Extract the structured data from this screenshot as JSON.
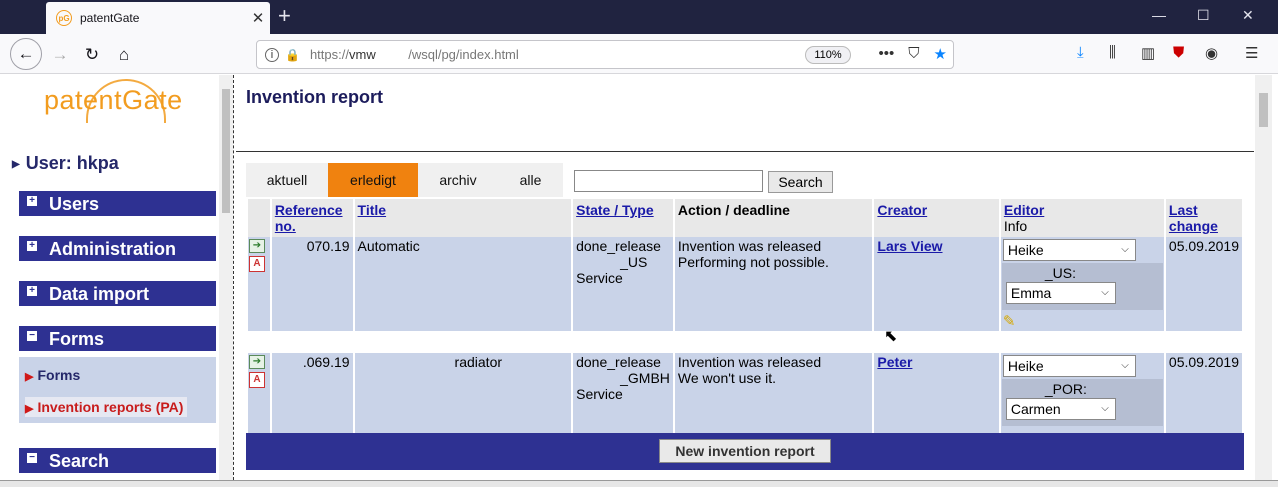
{
  "browser": {
    "tab_title": "patentGate",
    "favicon_text": "pG",
    "url_scheme": "https://",
    "url_host": "vmw",
    "url_path": "/wsql/pg/index.html",
    "zoom": "110%"
  },
  "sidebar": {
    "logo": "patentGate",
    "user": "User: hkpa",
    "menu": [
      {
        "label": "Users",
        "sign": "+"
      },
      {
        "label": "Administration",
        "sign": "+"
      },
      {
        "label": "Data import",
        "sign": "+"
      },
      {
        "label": "Forms",
        "sign": "−"
      },
      {
        "label": "Search",
        "sign": "−"
      }
    ],
    "submenu": [
      {
        "label": "Forms"
      },
      {
        "label": "Invention reports (PA)"
      }
    ]
  },
  "main": {
    "title": "Invention report",
    "filter_tabs": [
      {
        "label": "aktuell",
        "active": false
      },
      {
        "label": "erledigt",
        "active": true
      },
      {
        "label": "archiv",
        "active": false
      },
      {
        "label": "alle",
        "active": false
      }
    ],
    "search_button": "Search",
    "search_value": "",
    "columns": {
      "reference": "Reference no.",
      "title": "Title",
      "state": "State / Type",
      "action": "Action / deadline",
      "creator": "Creator",
      "editor": "Editor",
      "editor_sub": "Info",
      "last_change": "Last change"
    },
    "rows": [
      {
        "ref": "070.19",
        "title": "Automatic",
        "state_line1": "done_release",
        "state_line2": "_US",
        "state_line3": "Service",
        "action_line1": "Invention was released",
        "action_line2": "Performing not possible.",
        "creator": "Lars View",
        "editor": "Heike",
        "info_label": "_US:",
        "info_value": "Emma",
        "last_change": "05.09.2019"
      },
      {
        "ref": ".069.19",
        "title": "radiator",
        "state_line1": "done_release",
        "state_line2": "_GMBH",
        "state_line3": "Service",
        "action_line1": "Invention was released",
        "action_line2": "We won't use it.",
        "creator": "Peter",
        "editor": "Heike",
        "info_label": "_POR:",
        "info_value": "Carmen",
        "last_change": "05.09.2019"
      }
    ],
    "new_button": "New invention report"
  },
  "colors": {
    "menu_blue": "#2e3192",
    "active_tab_orange": "#f0820f",
    "row_bg": "#c9d3e8",
    "logo_orange": "#f29c1f"
  }
}
